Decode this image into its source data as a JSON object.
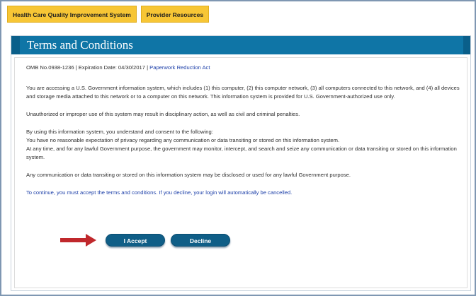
{
  "tabs": [
    {
      "label": "Health Care Quality Improvement System"
    },
    {
      "label": "Provider Resources"
    }
  ],
  "panel": {
    "title": "Terms and Conditions"
  },
  "omb": {
    "number": "OMB No.0938-1236",
    "expiration": "Expiration Date: 04/30/2017",
    "separator": "|",
    "link": "Paperwork Reduction Act"
  },
  "paragraphs": {
    "p1": "You are accessing a U.S. Government information system, which includes (1) this computer, (2) this computer network, (3) all computers connected to this network, and (4) all devices and storage media attached to this network or to a computer on this network. This information system is provided for U.S. Government-authorized use only.",
    "p2": "Unauthorized or improper use of this system may result in disciplinary action, as well as civil and criminal penalties.",
    "p3a": "By using this information system, you understand and consent to the following:",
    "p3b": "You have no reasonable expectation of privacy regarding any communication or data transiting or stored on this information system.",
    "p3c": "At any time, and for any lawful Government purpose, the government may monitor, intercept, and search and seize any communication or data transiting or stored on this information system.",
    "p4": "Any communication or data transiting or stored on this information system may be disclosed or used for any lawful Government purpose.",
    "p5": "To continue, you must accept the terms and conditions. If you decline, your login will automatically be cancelled."
  },
  "buttons": {
    "accept": "I Accept",
    "decline": "Decline"
  },
  "colors": {
    "tab_bg": "#f7c635",
    "header_bg": "#0f75a6",
    "button_bg": "#0f5e87",
    "arrow": "#c0282c",
    "link": "#1b3ea8"
  },
  "icons": {
    "pointer": "arrow-right-icon"
  }
}
